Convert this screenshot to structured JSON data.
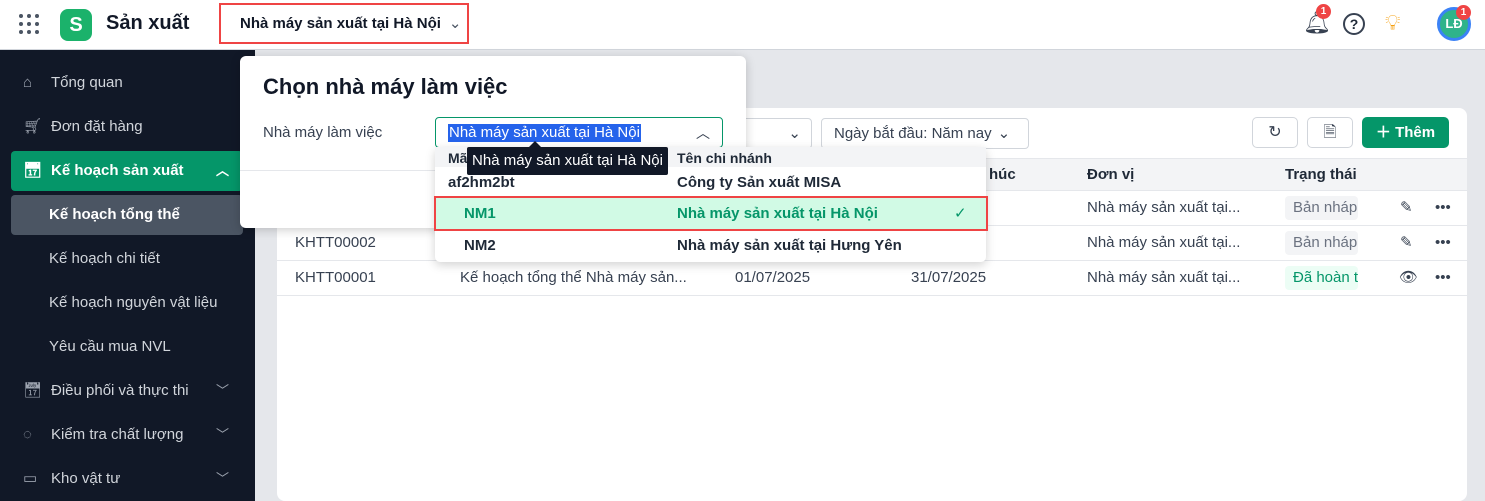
{
  "header": {
    "app_title": "Sản xuất",
    "factory_selector": "Nhà máy sản xuất tại Hà Nội",
    "notification_count": "1",
    "avatar_initials": "LĐ",
    "avatar_badge": "1"
  },
  "sidebar": {
    "items": [
      {
        "label": "Tổng quan",
        "icon": "home-icon"
      },
      {
        "label": "Đơn đặt hàng",
        "icon": "cart-icon"
      },
      {
        "label": "Kế hoạch sản xuất",
        "icon": "calendar-gear-icon",
        "expanded": true
      },
      {
        "label": "Kế hoạch tổng thể",
        "sub": true,
        "selected": true
      },
      {
        "label": "Kế hoạch chi tiết",
        "sub": true
      },
      {
        "label": "Kế hoạch nguyên vật liệu",
        "sub": true
      },
      {
        "label": "Yêu cầu mua NVL",
        "sub": true
      },
      {
        "label": "Điều phối và thực thi",
        "icon": "calendar-clock-icon"
      },
      {
        "label": "Kiểm tra chất lượng",
        "icon": "check-circle-icon"
      },
      {
        "label": "Kho vật tư",
        "icon": "archive-icon"
      }
    ]
  },
  "toolbar": {
    "date_filter": "Ngày bắt đầu: Năm nay",
    "add_label": "Thêm"
  },
  "table": {
    "columns": [
      "húc",
      "Đơn vị",
      "Trạng thái"
    ],
    "rows": [
      {
        "code": "",
        "name": "",
        "start": "",
        "end": "",
        "unit": "Nhà máy sản xuất tại...",
        "status": "Bản nháp",
        "action": "edit"
      },
      {
        "code": "KHTT00002",
        "name": "",
        "start": "",
        "end": "",
        "unit": "Nhà máy sản xuất tại...",
        "status": "Bản nháp",
        "action": "edit"
      },
      {
        "code": "KHTT00001",
        "name": "Kế hoạch tổng thể Nhà máy sản...",
        "start": "01/07/2025",
        "end": "31/07/2025",
        "unit": "Nhà máy sản xuất tại...",
        "status": "Đã hoàn t",
        "action": "view"
      }
    ]
  },
  "modal": {
    "title": "Chọn nhà máy làm việc",
    "field_label": "Nhà máy làm việc",
    "field_value": "Nhà máy sản xuất tại Hà Nội",
    "dropdown": {
      "col_code": "Mã",
      "col_name": "Tên chi nhánh",
      "options": [
        {
          "code": "af2hm2bt",
          "name": "Công ty Sản xuất MISA"
        },
        {
          "code": "NM1",
          "name": "Nhà máy sản xuất tại Hà Nội",
          "selected": true
        },
        {
          "code": "NM2",
          "name": "Nhà máy sản xuất tại Hưng Yên"
        }
      ]
    },
    "tooltip": "Nhà máy sản xuất tại Hà Nội"
  },
  "colors": {
    "accent": "#059669",
    "highlight": "#ef4444",
    "sidebar_bg": "#111827"
  }
}
